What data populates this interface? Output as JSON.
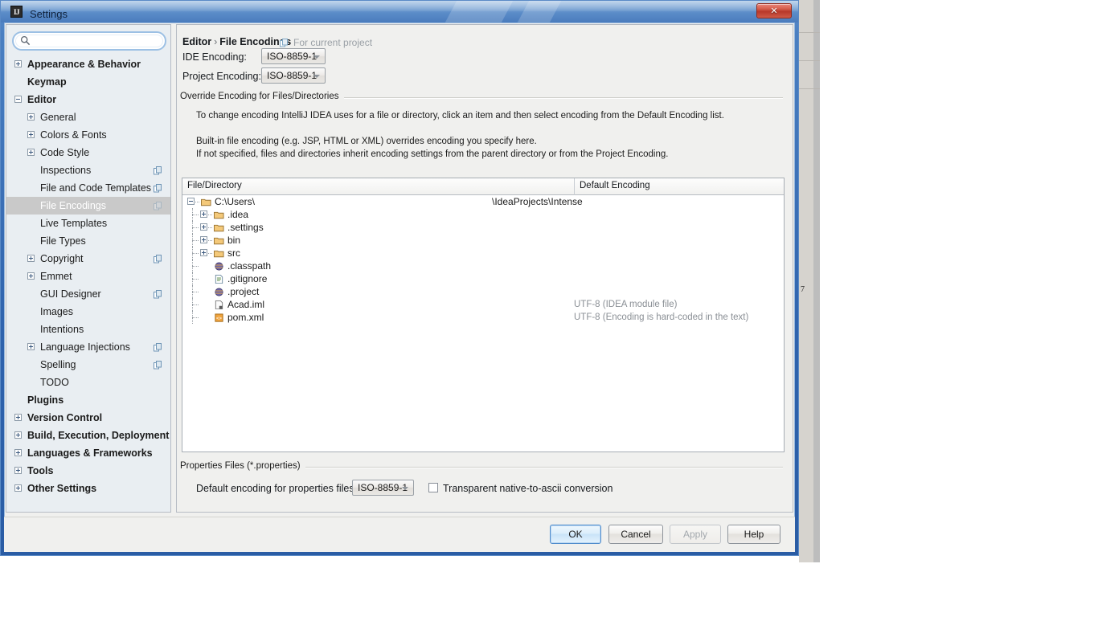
{
  "window": {
    "title": "Settings",
    "app_icon": "intellij-idea-icon",
    "close_label": "✕"
  },
  "search": {
    "value": "",
    "placeholder": "",
    "icon": "search-icon"
  },
  "sidebar": {
    "items": [
      {
        "label": "Appearance & Behavior",
        "depth": 0,
        "bold": true,
        "toggle": "plus",
        "scope_icon": false
      },
      {
        "label": "Keymap",
        "depth": 0,
        "bold": true,
        "toggle": "none",
        "scope_icon": false
      },
      {
        "label": "Editor",
        "depth": 0,
        "bold": true,
        "toggle": "minus",
        "scope_icon": false
      },
      {
        "label": "General",
        "depth": 1,
        "bold": false,
        "toggle": "plus",
        "scope_icon": false
      },
      {
        "label": "Colors & Fonts",
        "depth": 1,
        "bold": false,
        "toggle": "plus",
        "scope_icon": false
      },
      {
        "label": "Code Style",
        "depth": 1,
        "bold": false,
        "toggle": "plus",
        "scope_icon": false
      },
      {
        "label": "Inspections",
        "depth": 1,
        "bold": false,
        "toggle": "none",
        "scope_icon": true
      },
      {
        "label": "File and Code Templates",
        "depth": 1,
        "bold": false,
        "toggle": "none",
        "scope_icon": true
      },
      {
        "label": "File Encodings",
        "depth": 1,
        "bold": false,
        "toggle": "none",
        "scope_icon": true,
        "selected": true
      },
      {
        "label": "Live Templates",
        "depth": 1,
        "bold": false,
        "toggle": "none",
        "scope_icon": false
      },
      {
        "label": "File Types",
        "depth": 1,
        "bold": false,
        "toggle": "none",
        "scope_icon": false
      },
      {
        "label": "Copyright",
        "depth": 1,
        "bold": false,
        "toggle": "plus",
        "scope_icon": true
      },
      {
        "label": "Emmet",
        "depth": 1,
        "bold": false,
        "toggle": "plus",
        "scope_icon": false
      },
      {
        "label": "GUI Designer",
        "depth": 1,
        "bold": false,
        "toggle": "none",
        "scope_icon": true
      },
      {
        "label": "Images",
        "depth": 1,
        "bold": false,
        "toggle": "none",
        "scope_icon": false
      },
      {
        "label": "Intentions",
        "depth": 1,
        "bold": false,
        "toggle": "none",
        "scope_icon": false
      },
      {
        "label": "Language Injections",
        "depth": 1,
        "bold": false,
        "toggle": "plus",
        "scope_icon": true
      },
      {
        "label": "Spelling",
        "depth": 1,
        "bold": false,
        "toggle": "none",
        "scope_icon": true
      },
      {
        "label": "TODO",
        "depth": 1,
        "bold": false,
        "toggle": "none",
        "scope_icon": false
      },
      {
        "label": "Plugins",
        "depth": 0,
        "bold": true,
        "toggle": "none",
        "scope_icon": false
      },
      {
        "label": "Version Control",
        "depth": 0,
        "bold": true,
        "toggle": "plus",
        "scope_icon": false
      },
      {
        "label": "Build, Execution, Deployment",
        "depth": 0,
        "bold": true,
        "toggle": "plus",
        "scope_icon": false
      },
      {
        "label": "Languages & Frameworks",
        "depth": 0,
        "bold": true,
        "toggle": "plus",
        "scope_icon": false
      },
      {
        "label": "Tools",
        "depth": 0,
        "bold": true,
        "toggle": "plus",
        "scope_icon": false
      },
      {
        "label": "Other Settings",
        "depth": 0,
        "bold": true,
        "toggle": "plus",
        "scope_icon": false
      }
    ]
  },
  "main": {
    "breadcrumb_root": "Editor",
    "breadcrumb_sep": "›",
    "breadcrumb_leaf": "File Encodings",
    "scope_note": "For current project",
    "scope_note_icon": "project-scope-icon",
    "ide_encoding_label": "IDE Encoding:",
    "ide_encoding_value": "ISO-8859-1",
    "project_encoding_label": "Project Encoding:",
    "project_encoding_value": "ISO-8859-1",
    "override_group_title": "Override Encoding for Files/Directories",
    "description_line1": "To change encoding IntelliJ IDEA uses for a file or directory, click an item and then select encoding from the Default Encoding list.",
    "description_line2": "Built-in file encoding (e.g. JSP, HTML or XML) overrides encoding you specify here.",
    "description_line3": "If not specified, files and directories inherit encoding settings from the parent directory or from the Project Encoding.",
    "table": {
      "columns": [
        "File/Directory",
        "Default Encoding"
      ],
      "rows": [
        {
          "name": "C:\\Users\\",
          "extra": "\\IdeaProjects\\Intense",
          "encoding": "",
          "depth": 0,
          "toggle": "minus",
          "icon": "folder-icon"
        },
        {
          "name": ".idea",
          "extra": "",
          "encoding": "",
          "depth": 1,
          "toggle": "plus",
          "icon": "folder-icon"
        },
        {
          "name": ".settings",
          "extra": "",
          "encoding": "",
          "depth": 1,
          "toggle": "plus",
          "icon": "folder-icon"
        },
        {
          "name": "bin",
          "extra": "",
          "encoding": "",
          "depth": 1,
          "toggle": "plus",
          "icon": "folder-icon"
        },
        {
          "name": "src",
          "extra": "",
          "encoding": "",
          "depth": 1,
          "toggle": "plus",
          "icon": "folder-icon"
        },
        {
          "name": ".classpath",
          "extra": "",
          "encoding": "",
          "depth": 1,
          "toggle": "none",
          "icon": "sphere-file-icon"
        },
        {
          "name": ".gitignore",
          "extra": "",
          "encoding": "",
          "depth": 1,
          "toggle": "none",
          "icon": "text-file-icon"
        },
        {
          "name": ".project",
          "extra": "",
          "encoding": "",
          "depth": 1,
          "toggle": "none",
          "icon": "sphere-file-icon"
        },
        {
          "name": "Acad.iml",
          "extra": "",
          "encoding": "UTF-8 (IDEA module file)",
          "depth": 1,
          "toggle": "none",
          "icon": "module-file-icon"
        },
        {
          "name": "pom.xml",
          "extra": "",
          "encoding": "UTF-8 (Encoding is hard-coded in the text)",
          "depth": 1,
          "toggle": "none",
          "icon": "xml-file-icon"
        }
      ]
    },
    "properties_group_title": "Properties Files (*.properties)",
    "properties_encoding_label": "Default encoding for properties files:",
    "properties_encoding_value": "ISO-8859-1",
    "transparent_checkbox_label": "Transparent native-to-ascii conversion",
    "transparent_checkbox_checked": false
  },
  "buttons": {
    "ok": "OK",
    "cancel": "Cancel",
    "apply": "Apply",
    "help": "Help"
  },
  "colors": {
    "title_bar_blue": "#5b8cc8",
    "frame_blue": "#2f63ad",
    "selection_gray": "#c9c9c9",
    "muted_text": "#8a8f95",
    "accent_blue": "#4f8ccc"
  }
}
